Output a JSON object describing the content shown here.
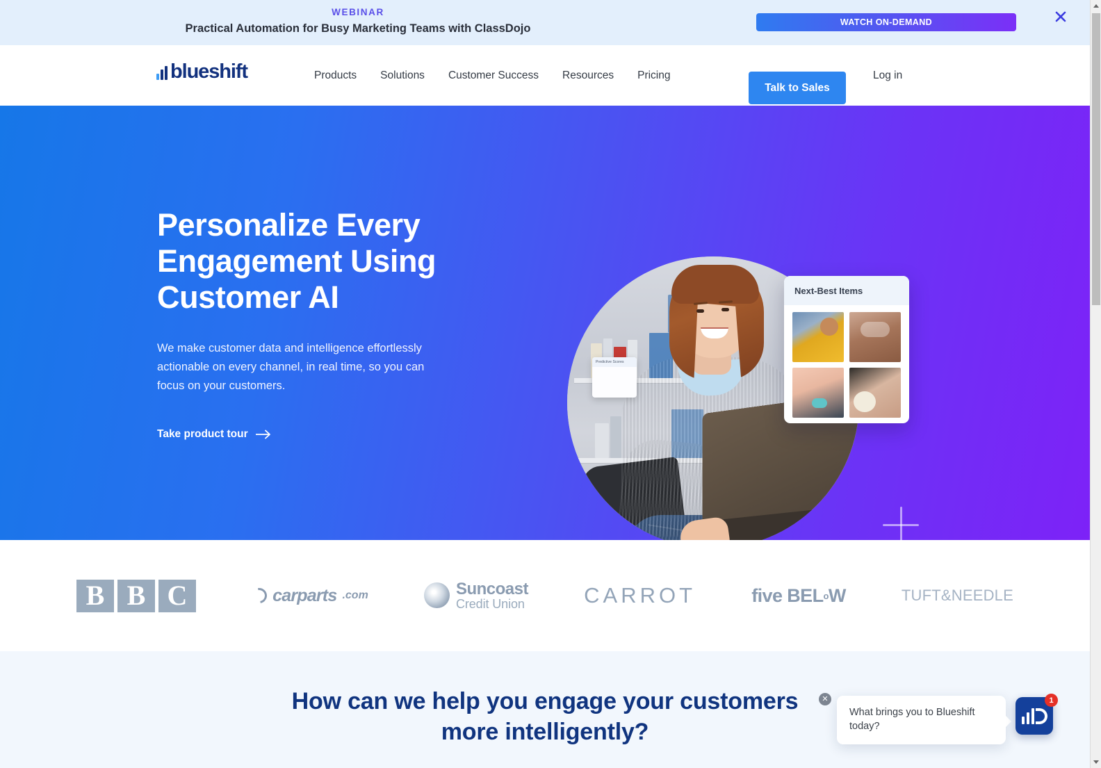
{
  "banner": {
    "eyebrow": "WEBINAR",
    "title": "Practical Automation for Busy Marketing Teams with ClassDojo",
    "cta_label": "WATCH ON-DEMAND",
    "close_label": "✕",
    "accent_start": "#2f7bf0",
    "accent_end": "#7b2ff7",
    "background": "#e3effc"
  },
  "nav": {
    "logo_text": "blueshift",
    "links": [
      {
        "label": "Products"
      },
      {
        "label": "Solutions"
      },
      {
        "label": "Customer Success"
      },
      {
        "label": "Resources"
      },
      {
        "label": "Pricing"
      }
    ],
    "cta_label": "Talk to Sales",
    "login_label": "Log in",
    "cta_color": "#2e86f0",
    "logo_color": "#12317e"
  },
  "hero": {
    "title": "Personalize Every Engagement Using Customer AI",
    "subtitle": "We make customer data and intelligence effortlessly actionable on every channel, in real time, so you can focus on your customers.",
    "link_label": "Take product tour",
    "gradient_start": "#1677e8",
    "gradient_end": "#7d22f7",
    "card_next_best": {
      "title": "Next-Best Items"
    },
    "card_predictive": {
      "title": "Predictive Scores"
    }
  },
  "clients": {
    "bbc": {
      "letters": [
        "B",
        "B",
        "C"
      ]
    },
    "carparts": {
      "word": "carparts",
      "tld": ".com"
    },
    "suncoast": {
      "line1": "Suncoast",
      "line2": "Credit Union"
    },
    "carrot": {
      "word": "CARROT"
    },
    "five_below": {
      "word_1": "five",
      "word_2": "BEL",
      "word_sup": "o",
      "word_3": "W"
    },
    "tuft": {
      "word": "TUFT&NEEDLE"
    },
    "logo_color": "#9aabbd"
  },
  "bottom": {
    "heading_line1": "How can we help you engage your customers",
    "heading_line2": "more intelligently?",
    "heading_color": "#10347f",
    "background": "#f2f7fd"
  },
  "chat": {
    "message": "What brings you to Blueshift today?",
    "badge_count": "1",
    "close_label": "✕",
    "launcher_color": "#14409b",
    "badge_color": "#e53027"
  },
  "scrollbar": {
    "up_label": "▲",
    "down_label": "▼"
  }
}
